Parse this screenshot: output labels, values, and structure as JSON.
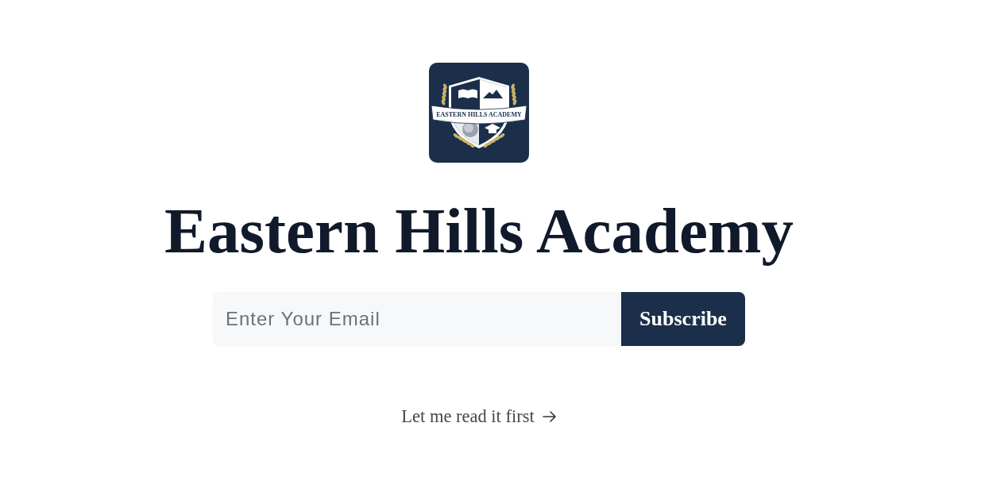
{
  "logo": {
    "banner_text": "EASTERN HILLS ACADEMY"
  },
  "title": "Eastern Hills Academy",
  "subscribe_form": {
    "email_field": {
      "placeholder": "Enter Your Email"
    },
    "button": "Subscribe"
  },
  "read_first_link": {
    "label": "Let me read it first"
  }
}
